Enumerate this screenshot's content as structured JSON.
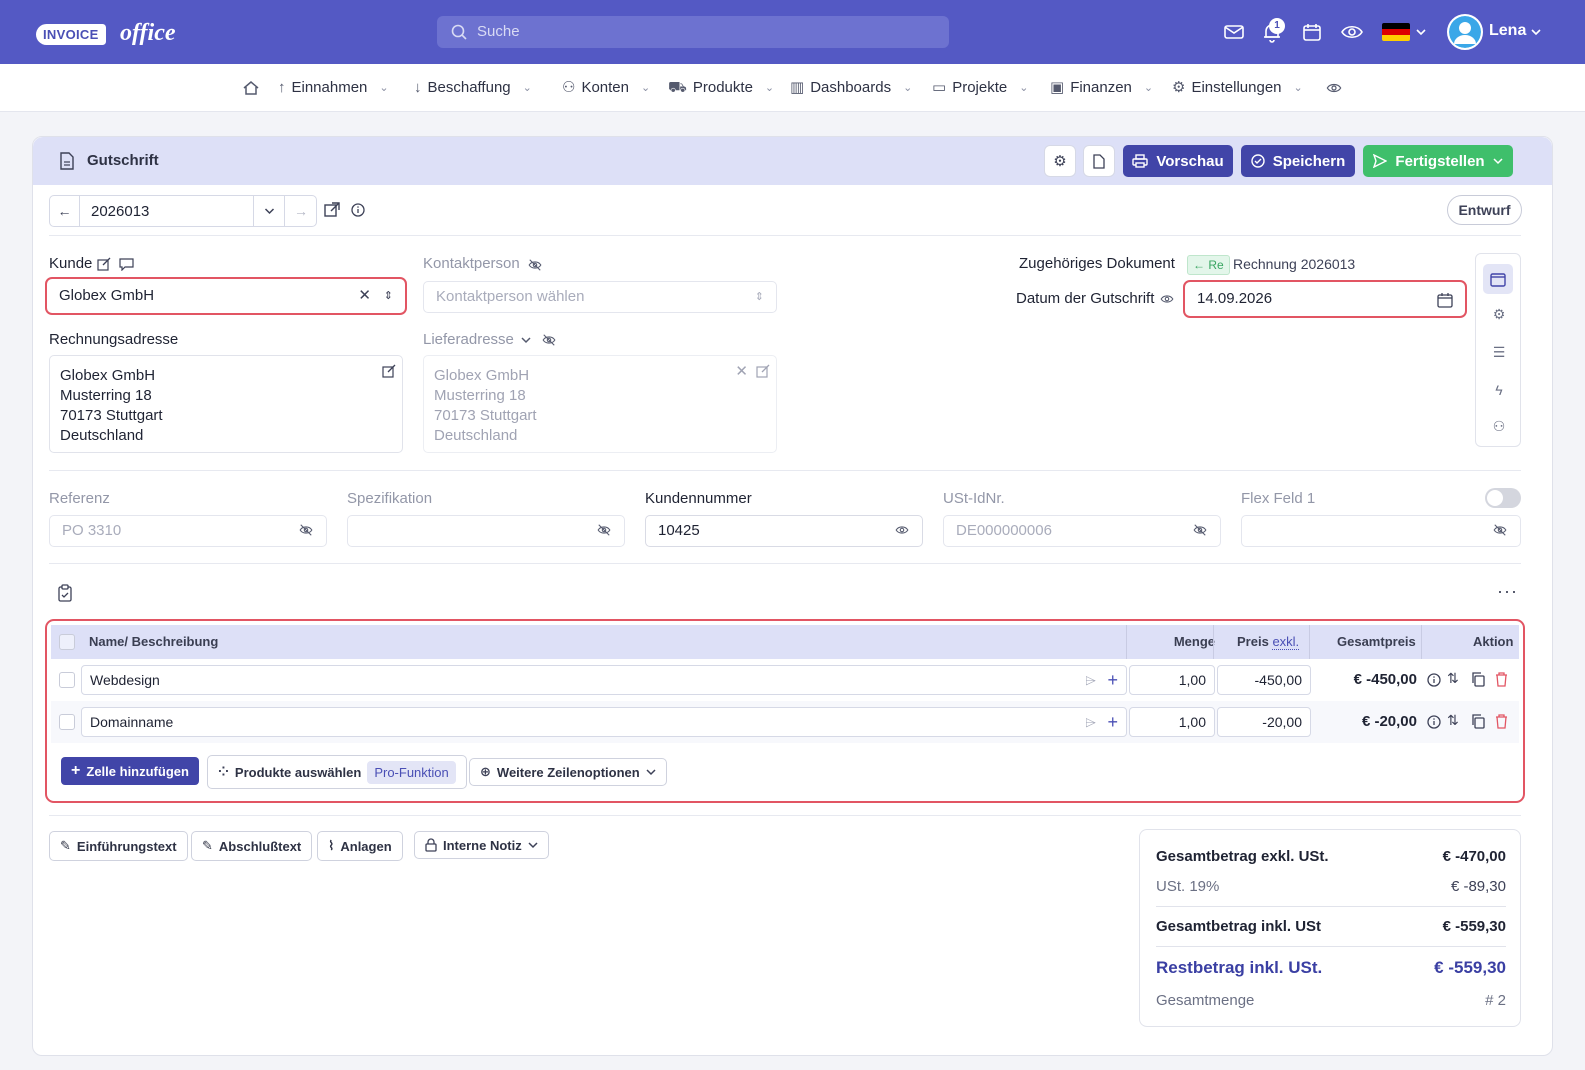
{
  "topbar": {
    "logo_badge": "INVOICE",
    "logo_word": "office",
    "search_placeholder": "Suche",
    "notifications_count": "1",
    "user_name": "Lena"
  },
  "nav": {
    "items": [
      {
        "label": "Einnahmen"
      },
      {
        "label": "Beschaffung"
      },
      {
        "label": "Konten"
      },
      {
        "label": "Produkte"
      },
      {
        "label": "Dashboards"
      },
      {
        "label": "Projekte"
      },
      {
        "label": "Finanzen"
      },
      {
        "label": "Einstellungen"
      }
    ]
  },
  "doc": {
    "title": "Gutschrift",
    "preview_label": "Vorschau",
    "save_label": "Speichern",
    "finish_label": "Fertigstellen",
    "number": "2026013",
    "status": "Entwurf"
  },
  "customer": {
    "label": "Kunde",
    "value": "Globex GmbH",
    "contact_label": "Kontaktperson",
    "contact_placeholder": "Kontaktperson wählen",
    "billing_label": "Rechnungsadresse",
    "billing_lines": [
      "Globex GmbH",
      "Musterring 18",
      "70173 Stuttgart",
      "Deutschland"
    ],
    "delivery_label": "Lieferadresse",
    "delivery_lines": [
      "Globex GmbH",
      "Musterring 18",
      "70173 Stuttgart",
      "Deutschland"
    ]
  },
  "related": {
    "label": "Zugehöriges Dokument",
    "tag": "Re",
    "doc": "Rechnung 2026013",
    "date_label": "Datum der Gutschrift",
    "date_value": "14.09.2026"
  },
  "meta": {
    "referenz_label": "Referenz",
    "referenz_value": "PO 3310",
    "spezifikation_label": "Spezifikation",
    "spezifikation_value": "",
    "kundennummer_label": "Kundennummer",
    "kundennummer_value": "10425",
    "ustid_label": "USt-IdNr.",
    "ustid_value": "DE000000006",
    "flex_label": "Flex Feld 1",
    "flex_value": ""
  },
  "table": {
    "headers": {
      "name": "Name/ Beschreibung",
      "qty": "Menge",
      "price": "Preis",
      "price_sub": "exkl.",
      "total": "Gesamtpreis",
      "action": "Aktion"
    },
    "rows": [
      {
        "name": "Webdesign",
        "qty": "1,00",
        "price": "-450,00",
        "total": "€ -450,00"
      },
      {
        "name": "Domainname",
        "qty": "1,00",
        "price": "-20,00",
        "total": "€ -20,00"
      }
    ],
    "add_row": "Zelle hinzufügen",
    "select_products": "Produkte auswählen",
    "pro_tag": "Pro-Funktion",
    "more_options": "Weitere Zeilenoptionen"
  },
  "footer_buttons": {
    "intro": "Einführungstext",
    "closing": "Abschlußtext",
    "attachments": "Anlagen",
    "internal_note": "Interne Notiz"
  },
  "summary": {
    "net_label": "Gesamtbetrag exkl. USt.",
    "net_value": "€ -470,00",
    "vat_label": "USt. 19%",
    "vat_value": "€ -89,30",
    "gross_label": "Gesamtbetrag inkl. USt",
    "gross_value": "€ -559,30",
    "rest_label": "Restbetrag inkl. USt.",
    "rest_value": "€ -559,30",
    "qty_label": "Gesamtmenge",
    "qty_value": "# 2"
  },
  "colors": {
    "brand": "#5459c4",
    "primary_button": "#4145a8",
    "success_button": "#3fbf6b",
    "highlight": "#e25563"
  }
}
